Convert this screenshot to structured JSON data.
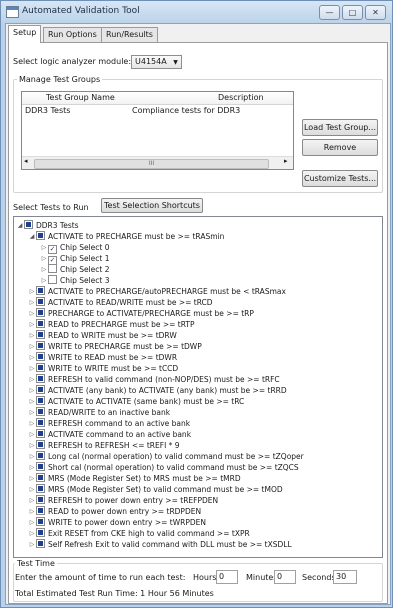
{
  "window": {
    "title": "Automated Validation Tool",
    "minimize": "—",
    "maximize": "□",
    "close": "✕"
  },
  "tabs": [
    {
      "label": "Setup",
      "active": true
    },
    {
      "label": "Run Options",
      "active": false
    },
    {
      "label": "Run/Results",
      "active": false
    }
  ],
  "module": {
    "label": "Select logic analyzer module:",
    "value": "U4154A",
    "arrow": "▼"
  },
  "manage": {
    "legend": "Manage Test Groups",
    "columns": [
      "Test Group Name",
      "Description"
    ],
    "rows": [
      {
        "name": "DDR3 Tests",
        "description": "Compliance tests for DDR3"
      }
    ],
    "scroll_left": "◂",
    "scroll_right": "▸",
    "thumb": "III",
    "buttons": {
      "load": "Load Test Group...",
      "remove": "Remove",
      "customize": "Customize Tests..."
    }
  },
  "select_tests": {
    "label": "Select Tests to Run",
    "shortcuts": "Test Selection Shortcuts",
    "tree": [
      {
        "label": "DDR3 Tests",
        "level": 0,
        "exp": "◢",
        "check": "partial"
      },
      {
        "label": "ACTIVATE to PRECHARGE must be >= tRASmin",
        "level": 1,
        "exp": "◢",
        "check": "partial"
      },
      {
        "label": "Chip Select 0",
        "level": 2,
        "exp": "▷",
        "check": "checked"
      },
      {
        "label": "Chip Select 1",
        "level": 2,
        "exp": "▷",
        "check": "checked"
      },
      {
        "label": "Chip Select 2",
        "level": 2,
        "exp": "▷",
        "check": "unchecked"
      },
      {
        "label": "Chip Select 3",
        "level": 2,
        "exp": "▷",
        "check": "unchecked"
      },
      {
        "label": "ACTIVATE to PRECHARGE/autoPRECHARGE must be < tRASmax",
        "level": 1,
        "exp": "▷",
        "check": "partial"
      },
      {
        "label": "ACTIVATE to READ/WRITE must be >= tRCD",
        "level": 1,
        "exp": "▷",
        "check": "partial"
      },
      {
        "label": "PRECHARGE to ACTIVATE/PRECHARGE must be >= tRP",
        "level": 1,
        "exp": "▷",
        "check": "partial"
      },
      {
        "label": "READ to PRECHARGE must be >= tRTP",
        "level": 1,
        "exp": "▷",
        "check": "partial"
      },
      {
        "label": "READ to WRITE must be >= tDRW",
        "level": 1,
        "exp": "▷",
        "check": "partial"
      },
      {
        "label": "WRITE to PRECHARGE must be >= tDWP",
        "level": 1,
        "exp": "▷",
        "check": "partial"
      },
      {
        "label": "WRITE to READ must be >= tDWR",
        "level": 1,
        "exp": "▷",
        "check": "partial"
      },
      {
        "label": "WRITE to WRITE must be >= tCCD",
        "level": 1,
        "exp": "▷",
        "check": "partial"
      },
      {
        "label": "REFRESH to valid command (non-NOP/DES) must be >= tRFC",
        "level": 1,
        "exp": "▷",
        "check": "partial"
      },
      {
        "label": "ACTIVATE (any bank) to ACTIVATE (any bank) must be >= tRRD",
        "level": 1,
        "exp": "▷",
        "check": "partial"
      },
      {
        "label": "ACTIVATE to ACTIVATE (same bank) must be >= tRC",
        "level": 1,
        "exp": "▷",
        "check": "partial"
      },
      {
        "label": "READ/WRITE to an inactive bank",
        "level": 1,
        "exp": "▷",
        "check": "partial"
      },
      {
        "label": "REFRESH command to an active bank",
        "level": 1,
        "exp": "▷",
        "check": "partial"
      },
      {
        "label": "ACTIVATE command to an active bank",
        "level": 1,
        "exp": "▷",
        "check": "partial"
      },
      {
        "label": "REFRESH to REFRESH <= tREFI * 9",
        "level": 1,
        "exp": "▷",
        "check": "partial"
      },
      {
        "label": "Long cal (normal operation) to valid command must be >= tZQoper",
        "level": 1,
        "exp": "▷",
        "check": "partial"
      },
      {
        "label": "Short cal (normal operation) to valid command must be >= tZQCS",
        "level": 1,
        "exp": "▷",
        "check": "partial"
      },
      {
        "label": "MRS (Mode Register Set) to MRS must be >= tMRD",
        "level": 1,
        "exp": "▷",
        "check": "partial"
      },
      {
        "label": "MRS (Mode Register Set) to valid command must be >= tMOD",
        "level": 1,
        "exp": "▷",
        "check": "partial"
      },
      {
        "label": "REFRESH to power down entry >= tREFPDEN",
        "level": 1,
        "exp": "▷",
        "check": "partial"
      },
      {
        "label": "READ to power down entry >= tRDPDEN",
        "level": 1,
        "exp": "▷",
        "check": "partial"
      },
      {
        "label": "WRITE to power down entry >= tWRPDEN",
        "level": 1,
        "exp": "▷",
        "check": "partial"
      },
      {
        "label": "Exit RESET from CKE high to valid command >= tXPR",
        "level": 1,
        "exp": "▷",
        "check": "partial"
      },
      {
        "label": "Self Refresh Exit to valid command with DLL must be >= tXSDLL",
        "level": 1,
        "exp": "▷",
        "check": "partial"
      }
    ]
  },
  "test_time": {
    "legend": "Test Time",
    "prompt": "Enter the amount of time to run each test:",
    "hours_label": "Hours:",
    "hours": "0",
    "minutes_label": "Minutes:",
    "minutes": "0",
    "seconds_label": "Seconds:",
    "seconds": "30",
    "total": "Total Estimated Test Run Time: 1 Hour 56 Minutes"
  }
}
